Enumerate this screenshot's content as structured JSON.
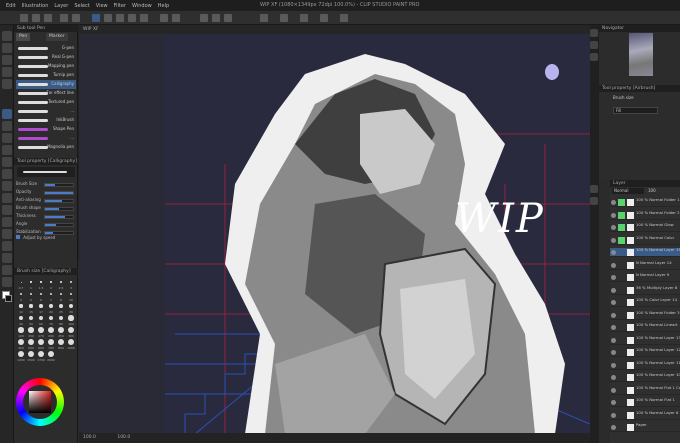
{
  "app": {
    "window_title": "WIP XF (1080×1349px 72dpi 100.0%) - CLIP STUDIO PAINT PRO",
    "menu": [
      "Edit",
      "Illustration",
      "Layer",
      "Select",
      "View",
      "Filter",
      "Window",
      "Help"
    ]
  },
  "subtool": {
    "panel_title": "Sub tool Pen",
    "tabs": [
      "Pen",
      "Marker"
    ],
    "brushes": [
      {
        "name": "G-pen"
      },
      {
        "name": "Real G-pen"
      },
      {
        "name": "Mapping pen"
      },
      {
        "name": "Turnip pen"
      },
      {
        "name": "Calligraphy"
      },
      {
        "name": "For effect line"
      },
      {
        "name": "Textured pen"
      },
      {
        "name": "..."
      },
      {
        "name": "InkBrush"
      },
      {
        "name": "Shape Pen"
      },
      {
        "name": "..."
      },
      {
        "name": "Magnolia pen"
      }
    ],
    "selected_brush_index": 4
  },
  "tool_property": {
    "title": "Tool property [Calligraphy]",
    "brush_name": "Calligraphy",
    "props": [
      {
        "label": "Brush Size",
        "value": 0.35
      },
      {
        "label": "Opacity",
        "value": 1.0
      },
      {
        "label": "Anti-aliasing",
        "value": 0.6
      },
      {
        "label": "Brush shape",
        "value": 0.5
      },
      {
        "label": "Thickness",
        "value": 0.7
      },
      {
        "label": "Angle",
        "value": 0.4
      },
      {
        "label": "Stabilization",
        "value": 0.3
      }
    ],
    "checkbox_label": "Adjust by speed"
  },
  "brush_size_panel": {
    "title": "Brush size [Calligraphy]",
    "sizes": [
      "0.7",
      "1",
      "1.5",
      "2",
      "2.5",
      "3",
      "4",
      "5",
      "6",
      "7",
      "8",
      "10",
      "12",
      "15",
      "17",
      "20",
      "25",
      "30",
      "40",
      "50",
      "60",
      "70",
      "80",
      "100",
      "120",
      "150",
      "170",
      "200",
      "250",
      "300",
      "400",
      "500",
      "600",
      "700",
      "800",
      "1000",
      "1200",
      "1500",
      "1700",
      "2000"
    ]
  },
  "canvas": {
    "tab": "WIP XF",
    "wip_text": "WIP"
  },
  "navigator": {
    "title": "Navigator"
  },
  "right_tool_property": {
    "title": "Tool property [Airbrush]",
    "label": "Brush size",
    "sub_label": "Fill"
  },
  "layers": {
    "header": "Layer",
    "blend_mode": "Normal",
    "opacity": "100",
    "rows": [
      {
        "name": "100 % Normal Folder 1",
        "green": true,
        "sel": false
      },
      {
        "name": "100 % Normal Folder 2",
        "green": true,
        "sel": false
      },
      {
        "name": "100 % Normal Glow",
        "green": true,
        "sel": false
      },
      {
        "name": "100 % Normal Color",
        "green": true,
        "sel": false
      },
      {
        "name": "100 % Normal Layer 15",
        "green": false,
        "sel": true
      },
      {
        "name": "N Normal Layer 14",
        "green": false,
        "sel": false
      },
      {
        "name": "N Normal Layer 9",
        "green": false,
        "sel": false
      },
      {
        "name": "36 % Multiply Layer 8",
        "green": false,
        "sel": false
      },
      {
        "name": "100 % Color Layer 14",
        "green": false,
        "sel": false
      },
      {
        "name": "100 % Normal Folder 3",
        "green": false,
        "sel": false
      },
      {
        "name": "100 % Normal Lineart",
        "green": false,
        "sel": false
      },
      {
        "name": "100 % Normal Layer 13",
        "green": false,
        "sel": false
      },
      {
        "name": "100 % Normal Layer 12",
        "green": false,
        "sel": false
      },
      {
        "name": "100 % Normal Layer 11",
        "green": false,
        "sel": false
      },
      {
        "name": "100 % Normal Layer 10",
        "green": false,
        "sel": false
      },
      {
        "name": "100 % Normal Flat 1 Copy",
        "green": false,
        "sel": false
      },
      {
        "name": "100 % Normal Flat 1",
        "green": false,
        "sel": false
      },
      {
        "name": "100 % Normal Layer 6",
        "green": false,
        "sel": false
      },
      {
        "name": "Paper",
        "green": false,
        "sel": false
      }
    ]
  },
  "status": {
    "zoom": "100.0",
    "coords": "100.0"
  },
  "colors": {
    "accent": "#3a5b86",
    "green_mark": "#5bd36c",
    "canvas_bg": "#292a3e",
    "moon": "#b9b3f0",
    "grid_line": "#b02040",
    "stairs": "#2d4fb8"
  }
}
